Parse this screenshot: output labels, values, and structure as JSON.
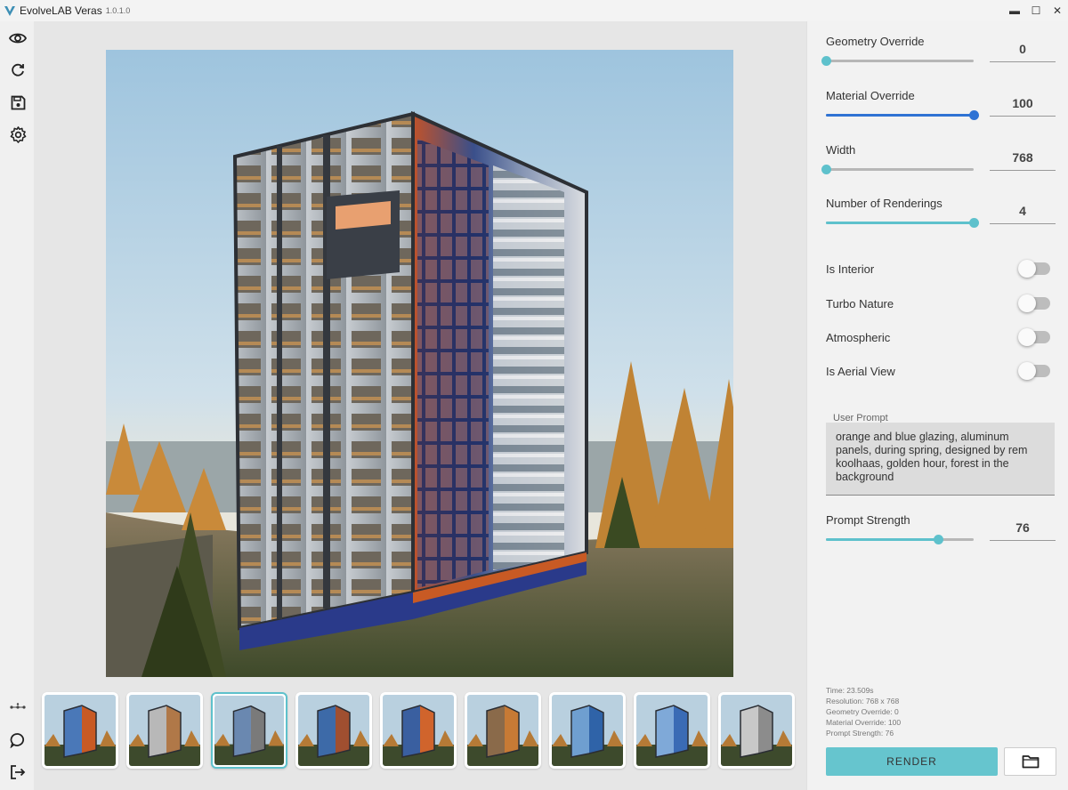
{
  "app": {
    "title": "EvolveLAB Veras",
    "version": "1.0.1.0"
  },
  "window": {
    "minimize": "▬",
    "maximize": "☐",
    "close": "✕"
  },
  "toolbar": [
    {
      "name": "eye-icon"
    },
    {
      "name": "refresh-icon"
    },
    {
      "name": "save-icon"
    },
    {
      "name": "gear-icon"
    }
  ],
  "toolbar_bottom": [
    {
      "name": "network-icon"
    },
    {
      "name": "chat-icon"
    },
    {
      "name": "logout-icon"
    }
  ],
  "sliders": {
    "geometry": {
      "label": "Geometry Override",
      "value": "0",
      "fraction": 0.0,
      "color": "#5ec1cc"
    },
    "material": {
      "label": "Material Override",
      "value": "100",
      "fraction": 1.0,
      "color": "#2f73d4"
    },
    "width": {
      "label": "Width",
      "value": "768",
      "fraction": 0.0,
      "color": "#5ec1cc"
    },
    "renderings": {
      "label": "Number of Renderings",
      "value": "4",
      "fraction": 1.0,
      "color": "#5ec1cc"
    },
    "strength": {
      "label": "Prompt Strength",
      "value": "76",
      "fraction": 0.76,
      "color": "#5ec1cc"
    }
  },
  "toggles": {
    "interior": {
      "label": "Is Interior",
      "on": false
    },
    "turbo": {
      "label": "Turbo Nature",
      "on": false
    },
    "atmospheric": {
      "label": "Atmospheric",
      "on": false
    },
    "aerial": {
      "label": "Is Aerial View",
      "on": false
    }
  },
  "prompt": {
    "label": "User Prompt",
    "value": "orange and blue glazing, aluminum panels, during spring, designed by rem koolhaas, golden hour, forest in the background"
  },
  "stats": {
    "time": "Time: 23.509s",
    "resolution": "Resolution: 768 x 768",
    "geometry": "Geometry Override: 0",
    "material": "Material Override: 100",
    "strength": "Prompt Strength: 76"
  },
  "render_label": "RENDER",
  "selected_thumbnail": 3,
  "thumbnails": [
    {
      "accent": "#c85a24",
      "glass": "#4a78b8"
    },
    {
      "accent": "#b07848",
      "glass": "#b8b8b8"
    },
    {
      "accent": "#7a7a7a",
      "glass": "#6a88b0"
    },
    {
      "accent": "#a04f30",
      "glass": "#3d6aa8"
    },
    {
      "accent": "#d0642c",
      "glass": "#3a5fa0"
    },
    {
      "accent": "#c77a35",
      "glass": "#8a6a4a"
    },
    {
      "accent": "#2f63a8",
      "glass": "#6f9fd0"
    },
    {
      "accent": "#3a6bb5",
      "glass": "#7fa9d8"
    },
    {
      "accent": "#8c8c8c",
      "glass": "#c8c8c8"
    }
  ]
}
